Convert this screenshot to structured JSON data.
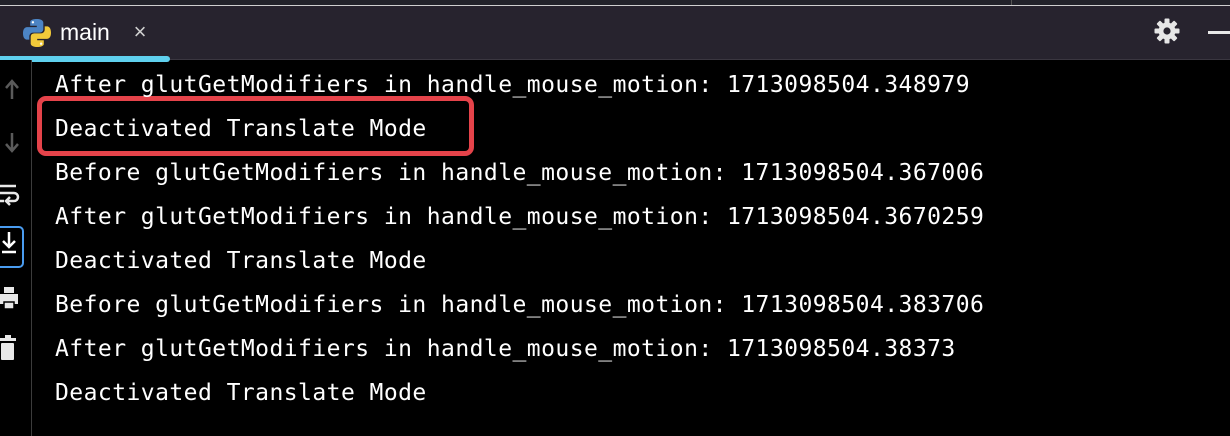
{
  "tab": {
    "label": "main",
    "close_symbol": "×",
    "icon": "python-icon"
  },
  "toolbar": {
    "settings_icon": "gear-icon",
    "minimize_icon": "minimize-icon"
  },
  "gutter": {
    "buttons": [
      "up-arrow-icon",
      "down-arrow-icon",
      "soft-wrap-icon",
      "scroll-to-end-icon",
      "print-icon",
      "trash-icon"
    ]
  },
  "console": {
    "lines": [
      "After glutGetModifiers in handle_mouse_motion: 1713098504.348979",
      "Deactivated Translate Mode",
      "Before glutGetModifiers in handle_mouse_motion: 1713098504.367006",
      "After glutGetModifiers in handle_mouse_motion: 1713098504.3670259",
      "Deactivated Translate Mode",
      "Before glutGetModifiers in handle_mouse_motion: 1713098504.383706",
      "After glutGetModifiers in handle_mouse_motion: 1713098504.38373",
      "Deactivated Translate Mode"
    ],
    "highlighted_line_index": 1
  },
  "colors": {
    "background": "#000000",
    "tabbar": "#27232e",
    "tab_accent": "#5fd0ee",
    "highlight": "#e5434a",
    "text": "#ffffff"
  }
}
